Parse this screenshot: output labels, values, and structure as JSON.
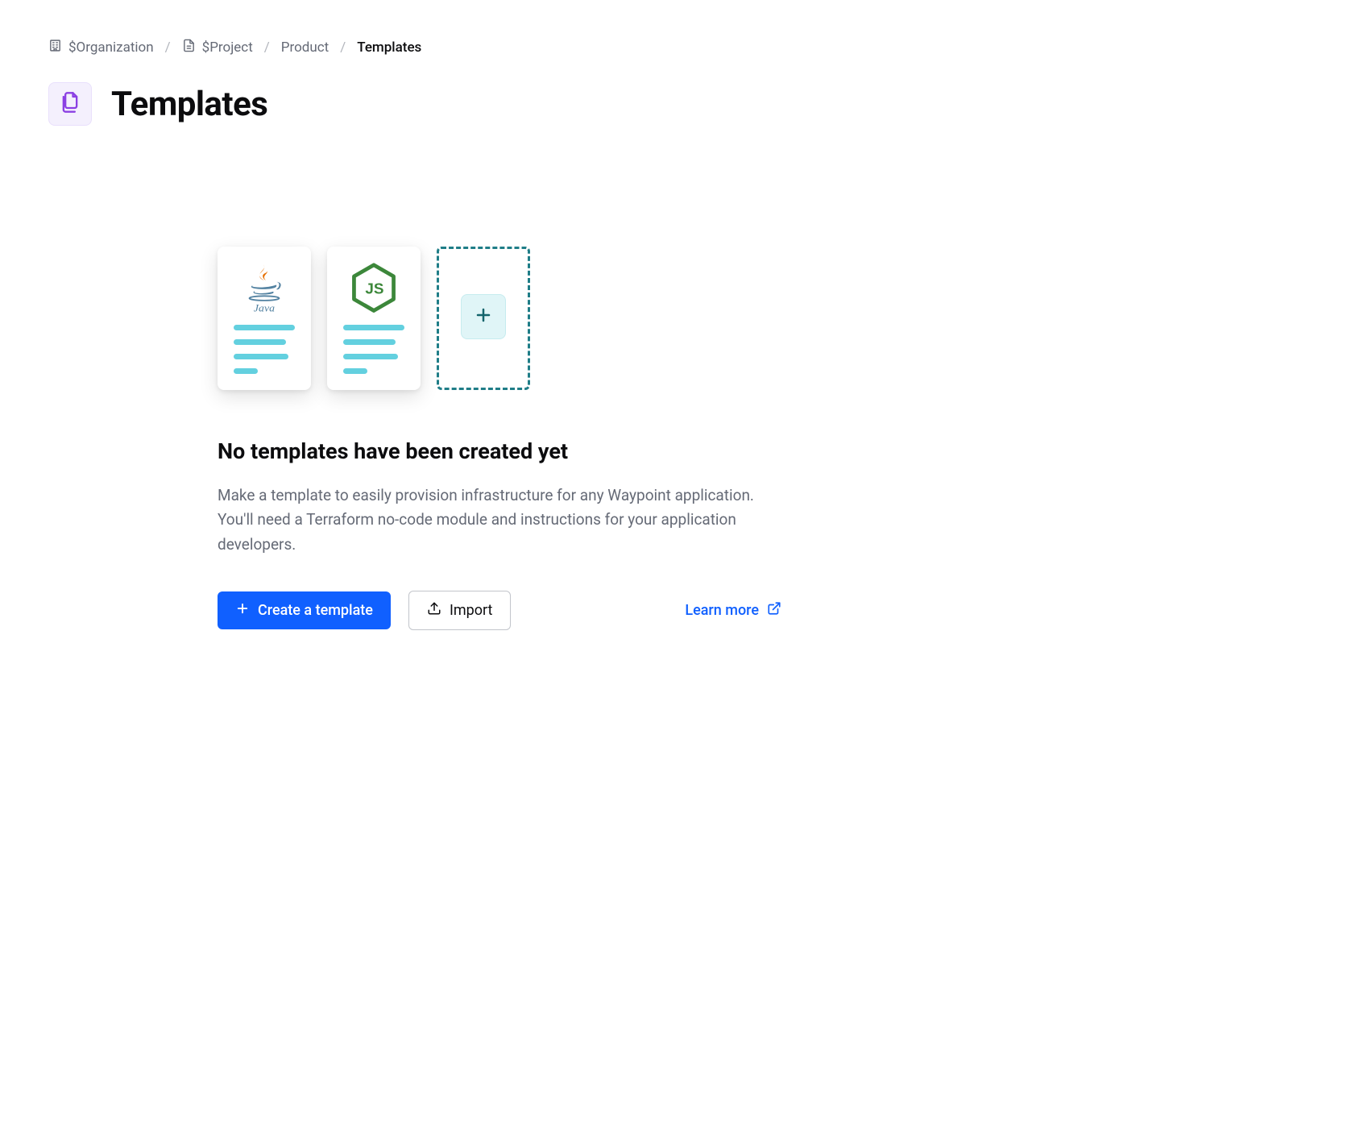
{
  "breadcrumb": {
    "org": "$Organization",
    "project": "$Project",
    "product": "Product",
    "current": "Templates"
  },
  "header": {
    "title": "Templates"
  },
  "empty": {
    "title": "No templates have been created yet",
    "description": "Make a template to easily provision infrastructure for any Waypoint application. You'll need a Terraform no-code module and instructions for your application developers.",
    "create_label": "Create a template",
    "import_label": "Import",
    "learn_more_label": "Learn more"
  },
  "icons": {
    "org": "building-icon",
    "project": "file-icon",
    "page": "files-icon",
    "plus": "plus-icon",
    "upload": "upload-icon",
    "external": "external-link-icon"
  }
}
